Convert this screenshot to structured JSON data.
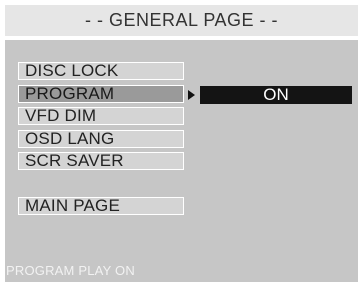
{
  "header": {
    "title": "- -  GENERAL PAGE  - -"
  },
  "menu": {
    "items": [
      {
        "label": "DISC LOCK"
      },
      {
        "label": "PROGRAM"
      },
      {
        "label": "VFD DIM"
      },
      {
        "label": "OSD LANG"
      },
      {
        "label": "SCR SAVER"
      }
    ],
    "main_page_label": "MAIN PAGE",
    "selected_index": 1
  },
  "submenu": {
    "value": "ON"
  },
  "status_bar": {
    "text": "PROGRAM PLAY ON"
  },
  "colors": {
    "panel": "#c6c6c6",
    "header": "#e6e6e6",
    "selected_item": "#9a9a9a",
    "option_box": "#141414"
  }
}
